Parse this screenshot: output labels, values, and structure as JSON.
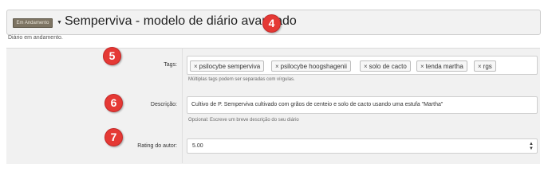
{
  "header": {
    "status_badge": "Em Andamento",
    "title": "Semperviva - modelo de diário avançado",
    "status_text": "Diário em andamento."
  },
  "markers": [
    "4",
    "5",
    "6",
    "7"
  ],
  "fields": {
    "tags": {
      "label": "Tags:",
      "items": [
        "psilocybe semperviva",
        "psilocybe hoogshagenii",
        "solo de cacto",
        "tenda martha",
        "rgs"
      ],
      "help": "Múltiplas tags podem ser separadas com vírgulas."
    },
    "description": {
      "label": "Descrição:",
      "value": "Cultivo de P. Semperviva cultivado com grãos de centeio e solo de cacto usando uma estufa \"Martha\"",
      "help": "Opcional: Escreve um breve descrição do seu diário"
    },
    "rating": {
      "label": "Rating do autor:",
      "value": "5.00"
    }
  },
  "colors": {
    "marker": "#e53935",
    "badge": "#7d7463",
    "panel": "#f1f1f1"
  },
  "icons": {
    "tag_remove": "×",
    "dropdown": "▼",
    "spinner_up": "▲",
    "spinner_down": "▼"
  }
}
